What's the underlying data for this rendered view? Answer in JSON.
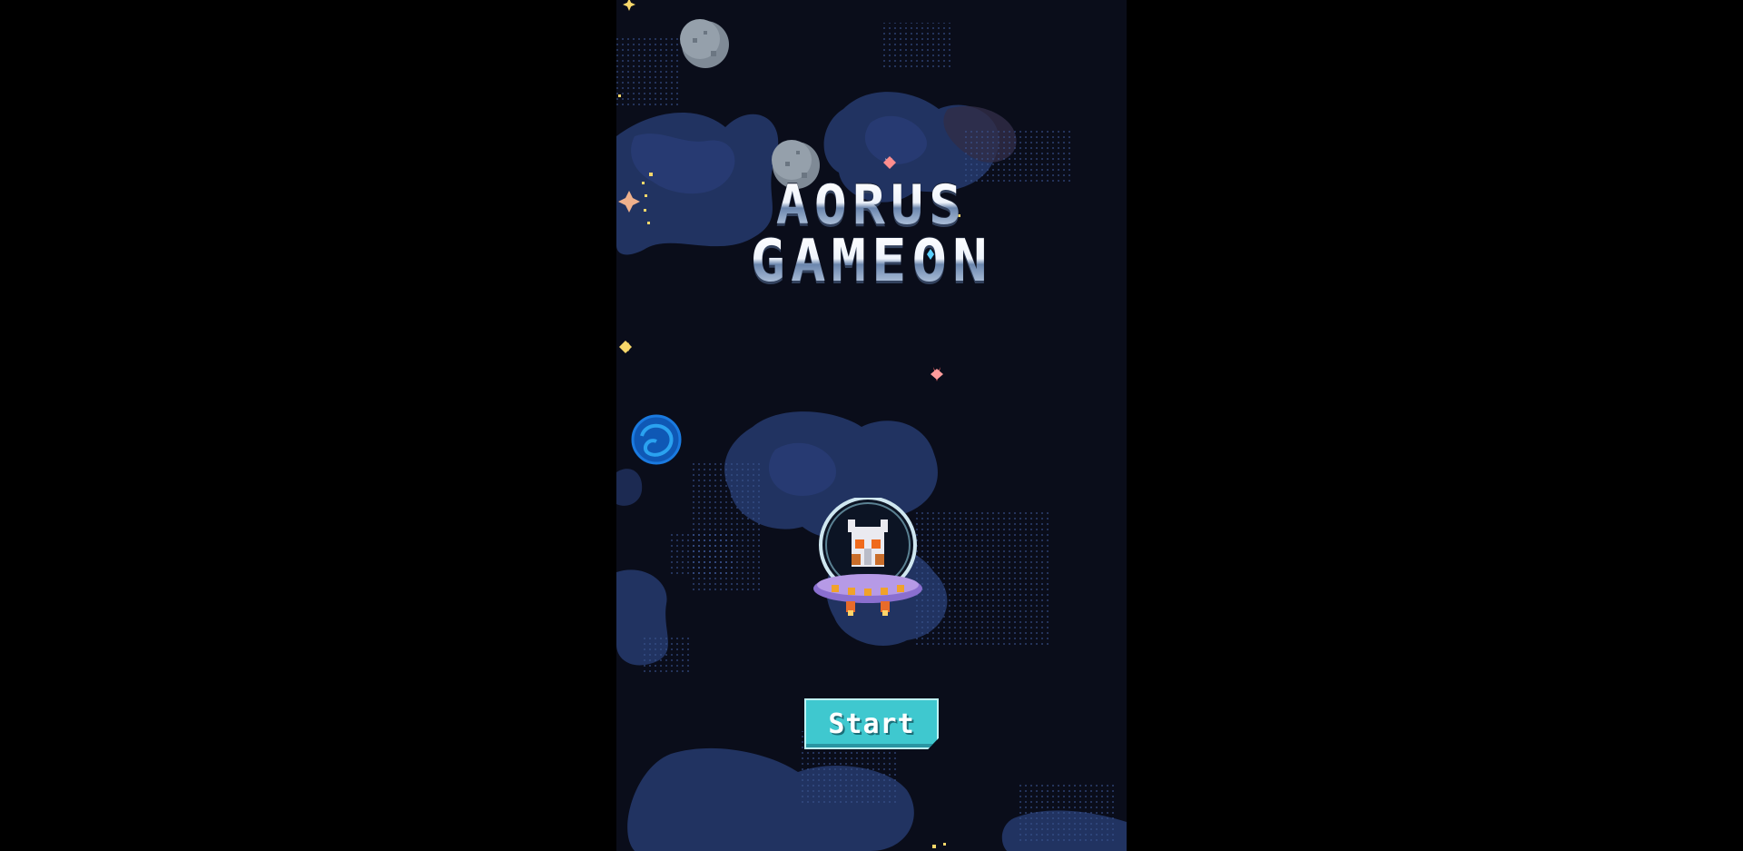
{
  "game": {
    "title_line_1": "AORUS",
    "title_line_2": "GAMEON",
    "start_label": "Start"
  },
  "colors": {
    "page_background": "#000000",
    "space_background": "#0a0d1a",
    "nebula": "#2f4680",
    "button_fill": "#3fc8cf",
    "button_text": "#ffffff",
    "saucer": "#a78bd6"
  },
  "sprites": {
    "player": "alien-pilot-in-saucer",
    "planets": [
      "grey-moon-icon",
      "grey-moon-icon",
      "blue-swirl-planet-icon"
    ],
    "stars": "sparkle-star-icon"
  }
}
